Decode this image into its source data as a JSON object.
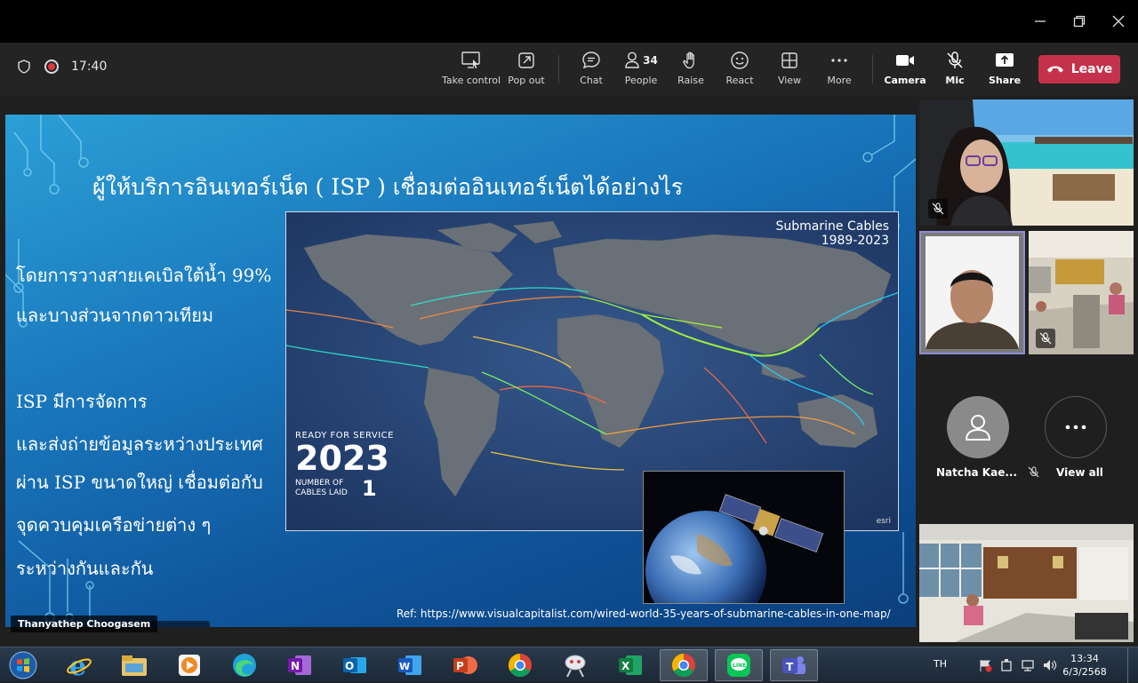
{
  "window": {
    "minimize_icon": "minimize-icon",
    "maximize_icon": "restore-icon",
    "close_icon": "close-icon"
  },
  "toolbar": {
    "timer": "17:40",
    "take_control": "Take control",
    "pop_out": "Pop out",
    "chat": "Chat",
    "people_count": "34",
    "people": "People",
    "raise": "Raise",
    "react": "React",
    "view": "View",
    "more": "More",
    "camera": "Camera",
    "mic": "Mic",
    "share": "Share",
    "leave": "Leave",
    "leave_color": "#c4314b"
  },
  "slide": {
    "title": "ผู้ให้บริการอินเทอร์เน็ต ( ISP ) เชื่อมต่ออินเทอร์เน็ตได้อย่างไร",
    "lines": [
      "โดยการวางสายเคเบิลใต้น้ำ 99%",
      "และบางส่วนจากดาวเทียม",
      "ISP มีการจัดการ",
      "และส่งถ่ายข้อมูลระหว่างประเทศ",
      "ผ่าน ISP ขนาดใหญ่ เชื่อมต่อกับ",
      "จุดควบคุมเครือข่ายต่าง ๆ",
      "ระหว่างกันและกัน"
    ],
    "map_title_1": "Submarine Cables",
    "map_title_2": "1989-2023",
    "ready_label": "READY FOR SERVICE",
    "ready_year": "2023",
    "cables_label_1": "NUMBER OF",
    "cables_label_2": "CABLES LAID",
    "cables_count": "1",
    "esri": "esri",
    "ref": "Ref: https://www.visualcapitalist.com/wired-world-35-years-of-submarine-cables-in-one-map/",
    "presenter": "Thanyathep Choogasem"
  },
  "participants": {
    "natcha": "Natcha Kae...",
    "view_all": "View all"
  },
  "taskbar": {
    "lang": "TH",
    "time": "13:34",
    "date": "6/3/2568"
  }
}
